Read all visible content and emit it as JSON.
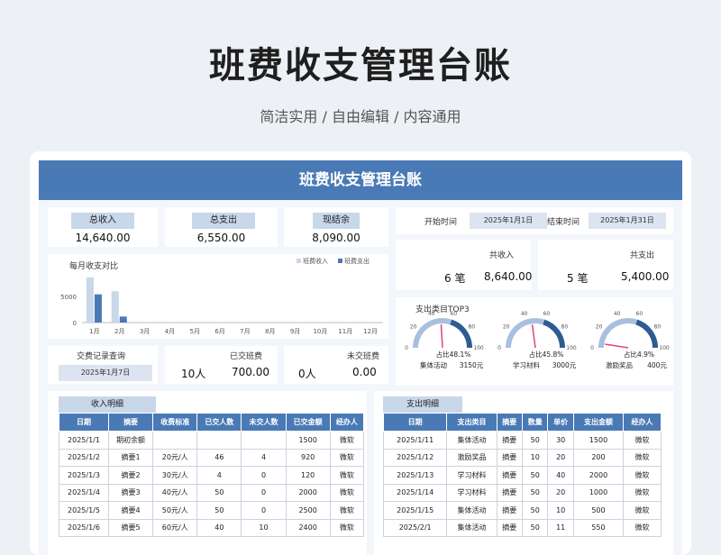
{
  "page": {
    "title": "班费收支管理台账",
    "subtitle": "简洁实用 / 自由编辑 / 内容通用"
  },
  "sheet": {
    "header": "班费收支管理台账"
  },
  "kpi": {
    "income_label": "总收入",
    "income_value": "14,640.00",
    "expense_label": "总支出",
    "expense_value": "6,550.00",
    "balance_label": "现结余",
    "balance_value": "8,090.00"
  },
  "period": {
    "start_label": "开始时间",
    "start_value": "2025年1月1日",
    "end_label": "结束时间",
    "end_value": "2025年1月31日"
  },
  "summary": {
    "income_label": "共收入",
    "income_count": "6 笔",
    "income_amount": "8,640.00",
    "expense_label": "共支出",
    "expense_count": "5 笔",
    "expense_amount": "5,400.00"
  },
  "records": {
    "query_label": "交费记录查询",
    "query_date": "2025年1月7日",
    "paid_label": "已交班费",
    "paid_count": "10人",
    "paid_amount": "700.00",
    "unpaid_label": "未交班费",
    "unpaid_count": "0人",
    "unpaid_amount": "0.00"
  },
  "colors": {
    "income": "#c9d7ea",
    "expense": "#4a7ab5",
    "header": "#4a7ab5"
  },
  "chart_data": [
    {
      "type": "bar",
      "title": "每月收支对比",
      "categories": [
        "1月",
        "2月",
        "3月",
        "4月",
        "5月",
        "6月",
        "7月",
        "8月",
        "9月",
        "10月",
        "11月",
        "12月"
      ],
      "series": [
        {
          "name": "班费收入",
          "values": [
            8640,
            6000,
            0,
            0,
            0,
            0,
            0,
            0,
            0,
            0,
            0,
            0
          ]
        },
        {
          "name": "班费支出",
          "values": [
            5400,
            1150,
            0,
            0,
            0,
            0,
            0,
            0,
            0,
            0,
            0,
            0
          ]
        }
      ],
      "yticks": [
        "0",
        "5000"
      ],
      "ylim": [
        0,
        10000
      ],
      "legend": "top-right"
    },
    {
      "type": "gauge",
      "title": "支出类目TOP3",
      "ticks": [
        "0",
        "20",
        "40",
        "60",
        "80",
        "100"
      ],
      "items": [
        {
          "name": "集体活动",
          "amount": "3150元",
          "pct_label": "占比48.1%",
          "pct": 48.1
        },
        {
          "name": "学习材料",
          "amount": "3000元",
          "pct_label": "占比45.8%",
          "pct": 45.8
        },
        {
          "name": "激励奖品",
          "amount": "400元",
          "pct_label": "占比4.9%",
          "pct": 4.9
        }
      ]
    }
  ],
  "income_table": {
    "tab": "收入明细",
    "headers": [
      "日期",
      "摘要",
      "收费标准",
      "已交人数",
      "未交人数",
      "已交金额",
      "经办人"
    ],
    "rows": [
      [
        "2025/1/1",
        "期初余额",
        "",
        "",
        "",
        "1500",
        "微软"
      ],
      [
        "2025/1/2",
        "摘要1",
        "20元/人",
        "46",
        "4",
        "920",
        "微软"
      ],
      [
        "2025/1/3",
        "摘要2",
        "30元/人",
        "4",
        "0",
        "120",
        "微软"
      ],
      [
        "2025/1/4",
        "摘要3",
        "40元/人",
        "50",
        "0",
        "2000",
        "微软"
      ],
      [
        "2025/1/5",
        "摘要4",
        "50元/人",
        "50",
        "0",
        "2500",
        "微软"
      ],
      [
        "2025/1/6",
        "摘要5",
        "60元/人",
        "40",
        "10",
        "2400",
        "微软"
      ]
    ]
  },
  "expense_table": {
    "tab": "支出明细",
    "headers": [
      "日期",
      "支出类目",
      "摘要",
      "数量",
      "单价",
      "支出金额",
      "经办人"
    ],
    "rows": [
      [
        "2025/1/11",
        "集体活动",
        "摘要",
        "50",
        "30",
        "1500",
        "微软"
      ],
      [
        "2025/1/12",
        "激励奖品",
        "摘要",
        "10",
        "20",
        "200",
        "微软"
      ],
      [
        "2025/1/13",
        "学习材料",
        "摘要",
        "50",
        "40",
        "2000",
        "微软"
      ],
      [
        "2025/1/14",
        "学习材料",
        "摘要",
        "50",
        "20",
        "1000",
        "微软"
      ],
      [
        "2025/1/15",
        "集体活动",
        "摘要",
        "50",
        "10",
        "500",
        "微软"
      ],
      [
        "2025/2/1",
        "集体活动",
        "摘要",
        "50",
        "11",
        "550",
        "微软"
      ]
    ]
  }
}
